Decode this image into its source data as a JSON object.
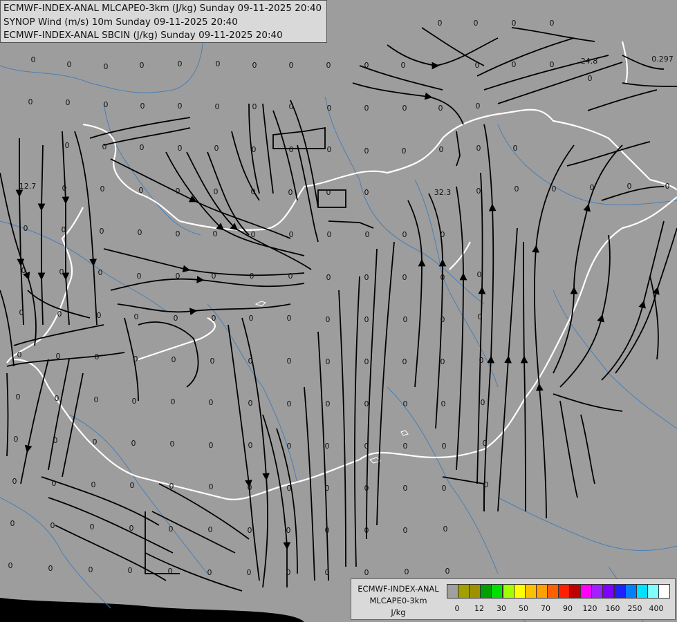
{
  "titles": [
    "ECMWF-INDEX-ANAL MLCAPE0-3km (J/kg) Sunday 09-11-2025 20:40",
    "SYNOP Wind (m/s) 10m Sunday 09-11-2025 20:40",
    "ECMWF-INDEX-ANAL SBCIN (J/kg) Sunday 09-11-2025 20:40"
  ],
  "legend": {
    "title_lines": [
      "ECMWF-INDEX-ANAL",
      "MLCAPE0-3km",
      "J/kg"
    ],
    "colors": [
      "#a0a0a0",
      "#a0a000",
      "#a09000",
      "#00a000",
      "#00e000",
      "#a0ff00",
      "#ffff00",
      "#ffc000",
      "#ffa000",
      "#ff6000",
      "#ff2000",
      "#c00000",
      "#ff00ff",
      "#a020ff",
      "#8000ff",
      "#2020ff",
      "#0080ff",
      "#00e0ff",
      "#80ffff",
      "#ffffff"
    ],
    "ticks": [
      "0",
      "12",
      "30",
      "50",
      "70",
      "90",
      "120",
      "160",
      "250",
      "400"
    ]
  },
  "values": [
    {
      "t": "0"
    },
    {
      "t": "0"
    },
    {
      "t": "0"
    },
    {
      "t": "0"
    },
    {
      "t": "0"
    },
    {
      "t": "0"
    },
    {
      "t": "0"
    },
    {
      "t": "0"
    },
    {
      "t": "0"
    },
    {
      "t": "0"
    },
    {
      "t": "0"
    },
    {
      "t": "0"
    },
    {
      "t": "0"
    },
    {
      "t": "0"
    },
    {
      "t": "0"
    },
    {
      "t": "0"
    },
    {
      "t": "0"
    },
    {
      "t": "0"
    },
    {
      "t": "0"
    },
    {
      "t": "24.8"
    },
    {
      "t": "0.297"
    },
    {
      "t": "0"
    },
    {
      "t": "0"
    },
    {
      "t": "0"
    },
    {
      "t": "0"
    },
    {
      "t": "0"
    },
    {
      "t": "0"
    },
    {
      "t": "0"
    },
    {
      "t": "0"
    },
    {
      "t": "0"
    },
    {
      "t": "0"
    },
    {
      "t": "0"
    },
    {
      "t": "0"
    },
    {
      "t": "0"
    },
    {
      "t": "0"
    },
    {
      "t": "0"
    },
    {
      "t": "0"
    },
    {
      "t": "0"
    },
    {
      "t": "0"
    },
    {
      "t": "0"
    },
    {
      "t": "0"
    },
    {
      "t": "0"
    },
    {
      "t": "0"
    },
    {
      "t": "0"
    },
    {
      "t": "0"
    },
    {
      "t": "0"
    },
    {
      "t": "0"
    },
    {
      "t": "12.7"
    },
    {
      "t": "0"
    },
    {
      "t": "0"
    },
    {
      "t": "0"
    },
    {
      "t": "0"
    },
    {
      "t": "0"
    },
    {
      "t": "0"
    },
    {
      "t": "0"
    },
    {
      "t": "0"
    },
    {
      "t": "0"
    },
    {
      "t": "32.3"
    },
    {
      "t": "0"
    },
    {
      "t": "0"
    },
    {
      "t": "0"
    },
    {
      "t": "0"
    },
    {
      "t": "0"
    },
    {
      "t": "0"
    },
    {
      "t": "0"
    },
    {
      "t": "0"
    },
    {
      "t": "0"
    },
    {
      "t": "0"
    },
    {
      "t": "0"
    },
    {
      "t": "0"
    },
    {
      "t": "0"
    },
    {
      "t": "0"
    },
    {
      "t": "0"
    },
    {
      "t": "0"
    },
    {
      "t": "0"
    },
    {
      "t": "0"
    },
    {
      "t": "0"
    },
    {
      "t": "0"
    },
    {
      "t": "0"
    },
    {
      "t": "0"
    },
    {
      "t": "0"
    },
    {
      "t": "0"
    },
    {
      "t": "0"
    },
    {
      "t": "0"
    },
    {
      "t": "0"
    },
    {
      "t": "0"
    },
    {
      "t": "0"
    },
    {
      "t": "0"
    },
    {
      "t": "0"
    },
    {
      "t": "0"
    },
    {
      "t": "0"
    },
    {
      "t": "0"
    },
    {
      "t": "0"
    },
    {
      "t": "0"
    },
    {
      "t": "0"
    },
    {
      "t": "0"
    },
    {
      "t": "0"
    },
    {
      "t": "0"
    },
    {
      "t": "0"
    },
    {
      "t": "0"
    },
    {
      "t": "0"
    },
    {
      "t": "0"
    },
    {
      "t": "0"
    },
    {
      "t": "0"
    },
    {
      "t": "0"
    },
    {
      "t": "0"
    },
    {
      "t": "0"
    },
    {
      "t": "0"
    },
    {
      "t": "0"
    },
    {
      "t": "0"
    },
    {
      "t": "0"
    },
    {
      "t": "0"
    },
    {
      "t": "0"
    },
    {
      "t": "0"
    },
    {
      "t": "0"
    },
    {
      "t": "0"
    },
    {
      "t": "0"
    },
    {
      "t": "0"
    },
    {
      "t": "0"
    },
    {
      "t": "0"
    },
    {
      "t": "0"
    },
    {
      "t": "0"
    },
    {
      "t": "0"
    },
    {
      "t": "0"
    },
    {
      "t": "0"
    },
    {
      "t": "0"
    },
    {
      "t": "0"
    },
    {
      "t": "0"
    },
    {
      "t": "0"
    },
    {
      "t": "0"
    },
    {
      "t": "0"
    },
    {
      "t": "0"
    },
    {
      "t": "0"
    },
    {
      "t": "0"
    },
    {
      "t": "0"
    },
    {
      "t": "0"
    },
    {
      "t": "0"
    },
    {
      "t": "0"
    },
    {
      "t": "0"
    },
    {
      "t": "0"
    },
    {
      "t": "0"
    },
    {
      "t": "0"
    },
    {
      "t": "0"
    },
    {
      "t": "0"
    },
    {
      "t": "0"
    },
    {
      "t": "0"
    },
    {
      "t": "0"
    },
    {
      "t": "0"
    },
    {
      "t": "0"
    },
    {
      "t": "0"
    },
    {
      "t": "0"
    },
    {
      "t": "0"
    },
    {
      "t": "0"
    },
    {
      "t": "0"
    },
    {
      "t": "0"
    },
    {
      "t": "0"
    },
    {
      "t": "0"
    },
    {
      "t": "0"
    },
    {
      "t": "0"
    },
    {
      "t": "0"
    },
    {
      "t": "0"
    },
    {
      "t": "0"
    },
    {
      "t": "0"
    },
    {
      "t": "0"
    },
    {
      "t": "0"
    },
    {
      "t": "0"
    },
    {
      "t": "0"
    },
    {
      "t": "0"
    },
    {
      "t": "0"
    },
    {
      "t": "0"
    },
    {
      "t": "0"
    },
    {
      "t": "0"
    },
    {
      "t": "0"
    },
    {
      "t": "0"
    },
    {
      "t": "0"
    },
    {
      "t": "0"
    },
    {
      "t": "0"
    },
    {
      "t": "0"
    }
  ],
  "colors": {
    "map_fill": "#9d9d9d",
    "outside": "#000000",
    "streamline": "#000000",
    "border": "#ffffff",
    "river": "#4a7fb5",
    "panel": "#d9d9d9"
  }
}
